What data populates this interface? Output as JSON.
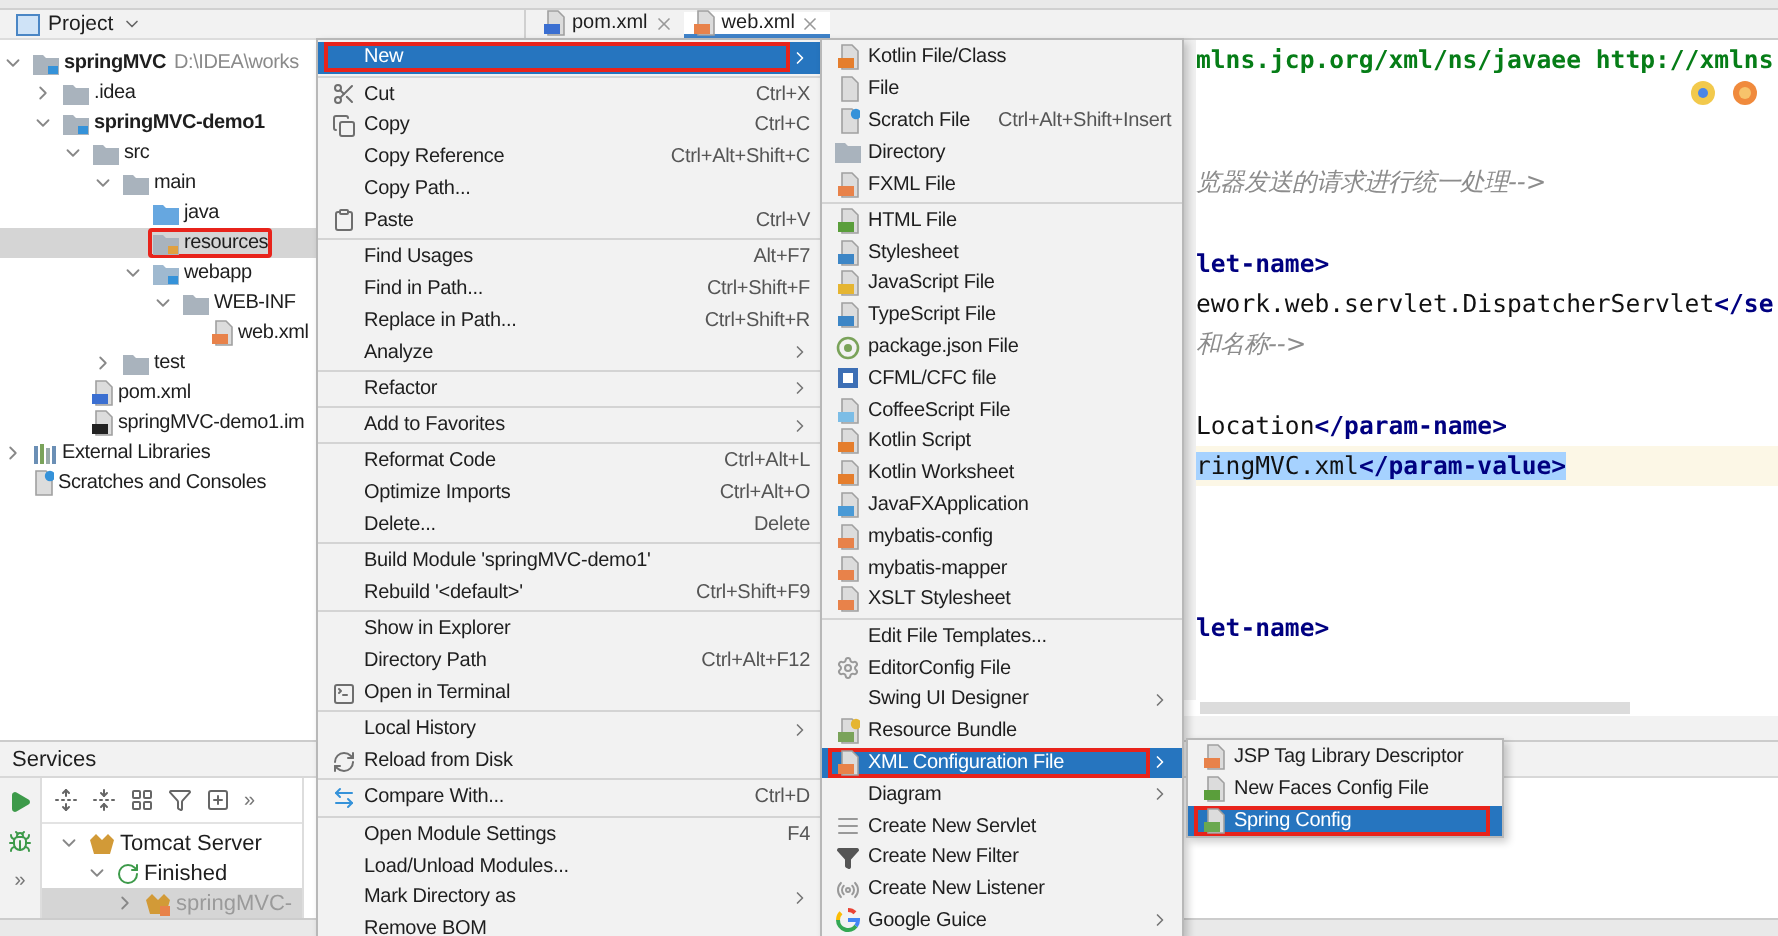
{
  "project_panel": {
    "title": "Project",
    "tree": [
      {
        "label": "springMVC",
        "path": "D:\\IDEA\\works",
        "kind": "module",
        "expanded": true,
        "selected": false,
        "marked": false,
        "children": [
          {
            "label": ".idea",
            "kind": "folder",
            "expanded": false,
            "selected": false,
            "marked": false
          },
          {
            "label": "springMVC-demo1",
            "kind": "module",
            "expanded": true,
            "selected": false,
            "marked": false,
            "children": [
              {
                "label": "src",
                "kind": "folder",
                "expanded": true,
                "selected": false,
                "marked": false,
                "children": [
                  {
                    "label": "main",
                    "kind": "folder",
                    "expanded": true,
                    "selected": false,
                    "marked": false,
                    "children": [
                      {
                        "label": "java",
                        "kind": "source",
                        "selected": false,
                        "marked": false
                      },
                      {
                        "label": "resources",
                        "kind": "resources",
                        "selected": true,
                        "marked": true
                      },
                      {
                        "label": "webapp",
                        "kind": "web",
                        "expanded": true,
                        "selected": false,
                        "marked": false,
                        "children": [
                          {
                            "label": "WEB-INF",
                            "kind": "folder",
                            "expanded": true,
                            "selected": false,
                            "marked": false,
                            "children": [
                              {
                                "label": "web.xml",
                                "kind": "xml",
                                "selected": false,
                                "marked": false
                              }
                            ]
                          }
                        ]
                      }
                    ]
                  },
                  {
                    "label": "test",
                    "kind": "folder",
                    "expanded": false,
                    "selected": false,
                    "marked": false
                  }
                ]
              },
              {
                "label": "pom.xml",
                "kind": "pom",
                "selected": false,
                "marked": false
              },
              {
                "label": "springMVC-demo1.im",
                "kind": "iml",
                "selected": false,
                "marked": false
              }
            ]
          }
        ]
      },
      {
        "label": "External Libraries",
        "kind": "libraries",
        "expanded": false,
        "selected": false,
        "marked": false
      },
      {
        "label": "Scratches and Consoles",
        "kind": "scratches",
        "selected": false,
        "marked": false
      }
    ]
  },
  "editor": {
    "tabs": [
      {
        "label": "pom.xml",
        "kind": "pom",
        "selected": false
      },
      {
        "label": "web.xml",
        "kind": "xml",
        "selected": true
      }
    ],
    "lines": [
      {
        "kind": "code",
        "current": false,
        "segments": [
          {
            "kind": "string",
            "text": "mlns.jcp.org/xml/ns/javaee http://xmlns",
            "selected": false
          }
        ]
      },
      {
        "kind": "blank"
      },
      {
        "kind": "blank"
      },
      {
        "kind": "code",
        "current": false,
        "segments": [
          {
            "kind": "comment",
            "text": "览器发送的请求进行统一处理-->",
            "selected": false
          }
        ]
      },
      {
        "kind": "blank"
      },
      {
        "kind": "code",
        "current": false,
        "segments": [
          {
            "kind": "tag",
            "text": "let-name>",
            "selected": false
          }
        ]
      },
      {
        "kind": "code",
        "current": false,
        "segments": [
          {
            "kind": "text",
            "text": "ework.web.servlet.DispatcherServlet",
            "selected": false
          },
          {
            "kind": "tag",
            "text": "</se",
            "selected": false
          }
        ]
      },
      {
        "kind": "code",
        "current": false,
        "segments": [
          {
            "kind": "comment",
            "text": "和名称-->",
            "selected": false
          }
        ]
      },
      {
        "kind": "blank"
      },
      {
        "kind": "code",
        "current": false,
        "segments": [
          {
            "kind": "text",
            "text": "Location",
            "selected": false
          },
          {
            "kind": "tag",
            "text": "</param-name>",
            "selected": false
          }
        ]
      },
      {
        "kind": "code",
        "current": true,
        "segments": [
          {
            "kind": "text",
            "text": "ringMVC.xml",
            "selected": true
          },
          {
            "kind": "tag",
            "text": "</param-value>",
            "selected": true
          }
        ]
      },
      {
        "kind": "blank"
      },
      {
        "kind": "blank"
      },
      {
        "kind": "blank"
      },
      {
        "kind": "code",
        "current": false,
        "segments": [
          {
            "kind": "tag",
            "text": "let-name>",
            "selected": false
          }
        ]
      }
    ]
  },
  "services": {
    "title": "Services",
    "toolbar_more": "»",
    "side_more": "»",
    "tree": [
      {
        "label": "Tomcat Server",
        "kind": "server",
        "expanded": true,
        "selected": false,
        "children": [
          {
            "label": "Finished",
            "kind": "status",
            "expanded": true,
            "selected": false,
            "children": [
              {
                "label": "springMVC-",
                "kind": "deployment",
                "expanded": false,
                "selected": true
              }
            ]
          }
        ]
      }
    ]
  },
  "context_menu": {
    "items": [
      {
        "kind": "submenu",
        "label": "New",
        "selected": true,
        "marked": true
      },
      {
        "kind": "separator"
      },
      {
        "kind": "item",
        "label": "Cut",
        "shortcut": "Ctrl+X",
        "selected": false,
        "marked": false
      },
      {
        "kind": "item",
        "label": "Copy",
        "shortcut": "Ctrl+C",
        "selected": false,
        "marked": false
      },
      {
        "kind": "item",
        "label": "Copy Reference",
        "shortcut": "Ctrl+Alt+Shift+C",
        "selected": false,
        "marked": false
      },
      {
        "kind": "item",
        "label": "Copy Path...",
        "selected": false,
        "marked": false
      },
      {
        "kind": "item",
        "label": "Paste",
        "shortcut": "Ctrl+V",
        "selected": false,
        "marked": false
      },
      {
        "kind": "separator"
      },
      {
        "kind": "item",
        "label": "Find Usages",
        "shortcut": "Alt+F7",
        "selected": false,
        "marked": false
      },
      {
        "kind": "item",
        "label": "Find in Path...",
        "shortcut": "Ctrl+Shift+F",
        "selected": false,
        "marked": false
      },
      {
        "kind": "item",
        "label": "Replace in Path...",
        "shortcut": "Ctrl+Shift+R",
        "selected": false,
        "marked": false
      },
      {
        "kind": "submenu",
        "label": "Analyze",
        "selected": false,
        "marked": false
      },
      {
        "kind": "separator"
      },
      {
        "kind": "submenu",
        "label": "Refactor",
        "selected": false,
        "marked": false
      },
      {
        "kind": "separator"
      },
      {
        "kind": "submenu",
        "label": "Add to Favorites",
        "selected": false,
        "marked": false
      },
      {
        "kind": "separator"
      },
      {
        "kind": "item",
        "label": "Reformat Code",
        "shortcut": "Ctrl+Alt+L",
        "selected": false,
        "marked": false
      },
      {
        "kind": "item",
        "label": "Optimize Imports",
        "shortcut": "Ctrl+Alt+O",
        "selected": false,
        "marked": false
      },
      {
        "kind": "item",
        "label": "Delete...",
        "shortcut": "Delete",
        "selected": false,
        "marked": false
      },
      {
        "kind": "separator"
      },
      {
        "kind": "item",
        "label": "Build Module 'springMVC-demo1'",
        "selected": false,
        "marked": false
      },
      {
        "kind": "item",
        "label": "Rebuild '<default>'",
        "shortcut": "Ctrl+Shift+F9",
        "selected": false,
        "marked": false
      },
      {
        "kind": "separator"
      },
      {
        "kind": "item",
        "label": "Show in Explorer",
        "selected": false,
        "marked": false
      },
      {
        "kind": "item",
        "label": "Directory Path",
        "shortcut": "Ctrl+Alt+F12",
        "selected": false,
        "marked": false
      },
      {
        "kind": "item",
        "label": "Open in Terminal",
        "selected": false,
        "marked": false
      },
      {
        "kind": "separator"
      },
      {
        "kind": "submenu",
        "label": "Local History",
        "selected": false,
        "marked": false
      },
      {
        "kind": "item",
        "label": "Reload from Disk",
        "selected": false,
        "marked": false
      },
      {
        "kind": "separator"
      },
      {
        "kind": "item",
        "label": "Compare With...",
        "shortcut": "Ctrl+D",
        "selected": false,
        "marked": false
      },
      {
        "kind": "separator"
      },
      {
        "kind": "item",
        "label": "Open Module Settings",
        "shortcut": "F4",
        "selected": false,
        "marked": false
      },
      {
        "kind": "item",
        "label": "Load/Unload Modules...",
        "selected": false,
        "marked": false
      },
      {
        "kind": "submenu",
        "label": "Mark Directory as",
        "selected": false,
        "marked": false
      },
      {
        "kind": "item",
        "label": "Remove BOM",
        "selected": false,
        "marked": false
      }
    ]
  },
  "new_submenu": {
    "items": [
      {
        "kind": "item",
        "label": "Kotlin File/Class",
        "selected": false,
        "marked": false
      },
      {
        "kind": "item",
        "label": "File",
        "selected": false,
        "marked": false
      },
      {
        "kind": "item",
        "label": "Scratch File",
        "shortcut": "Ctrl+Alt+Shift+Insert",
        "selected": false,
        "marked": false
      },
      {
        "kind": "item",
        "label": "Directory",
        "selected": false,
        "marked": false
      },
      {
        "kind": "item",
        "label": "FXML File",
        "selected": false,
        "marked": false
      },
      {
        "kind": "separator"
      },
      {
        "kind": "item",
        "label": "HTML File",
        "selected": false,
        "marked": false
      },
      {
        "kind": "item",
        "label": "Stylesheet",
        "selected": false,
        "marked": false
      },
      {
        "kind": "item",
        "label": "JavaScript File",
        "selected": false,
        "marked": false
      },
      {
        "kind": "item",
        "label": "TypeScript File",
        "selected": false,
        "marked": false
      },
      {
        "kind": "item",
        "label": "package.json File",
        "selected": false,
        "marked": false
      },
      {
        "kind": "item",
        "label": "CFML/CFC file",
        "selected": false,
        "marked": false
      },
      {
        "kind": "item",
        "label": "CoffeeScript File",
        "selected": false,
        "marked": false
      },
      {
        "kind": "item",
        "label": "Kotlin Script",
        "selected": false,
        "marked": false
      },
      {
        "kind": "item",
        "label": "Kotlin Worksheet",
        "selected": false,
        "marked": false
      },
      {
        "kind": "item",
        "label": "JavaFXApplication",
        "selected": false,
        "marked": false
      },
      {
        "kind": "item",
        "label": "mybatis-config",
        "selected": false,
        "marked": false
      },
      {
        "kind": "item",
        "label": "mybatis-mapper",
        "selected": false,
        "marked": false
      },
      {
        "kind": "item",
        "label": "XSLT Stylesheet",
        "selected": false,
        "marked": false
      },
      {
        "kind": "separator"
      },
      {
        "kind": "item",
        "label": "Edit File Templates...",
        "selected": false,
        "marked": false
      },
      {
        "kind": "item",
        "label": "EditorConfig File",
        "selected": false,
        "marked": false
      },
      {
        "kind": "submenu",
        "label": "Swing UI Designer",
        "selected": false,
        "marked": false
      },
      {
        "kind": "item",
        "label": "Resource Bundle",
        "selected": false,
        "marked": false
      },
      {
        "kind": "submenu",
        "label": "XML Configuration File",
        "selected": true,
        "marked": true
      },
      {
        "kind": "submenu",
        "label": "Diagram",
        "selected": false,
        "marked": false
      },
      {
        "kind": "item",
        "label": "Create New Servlet",
        "selected": false,
        "marked": false
      },
      {
        "kind": "item",
        "label": "Create New Filter",
        "selected": false,
        "marked": false
      },
      {
        "kind": "item",
        "label": "Create New Listener",
        "selected": false,
        "marked": false
      },
      {
        "kind": "submenu",
        "label": "Google Guice",
        "selected": false,
        "marked": false
      }
    ]
  },
  "xml_submenu": {
    "items": [
      {
        "kind": "item",
        "label": "JSP Tag Library Descriptor",
        "selected": false,
        "marked": false
      },
      {
        "kind": "item",
        "label": "New Faces Config File",
        "selected": false,
        "marked": false
      },
      {
        "kind": "item",
        "label": "Spring Config",
        "selected": true,
        "marked": true
      }
    ]
  }
}
